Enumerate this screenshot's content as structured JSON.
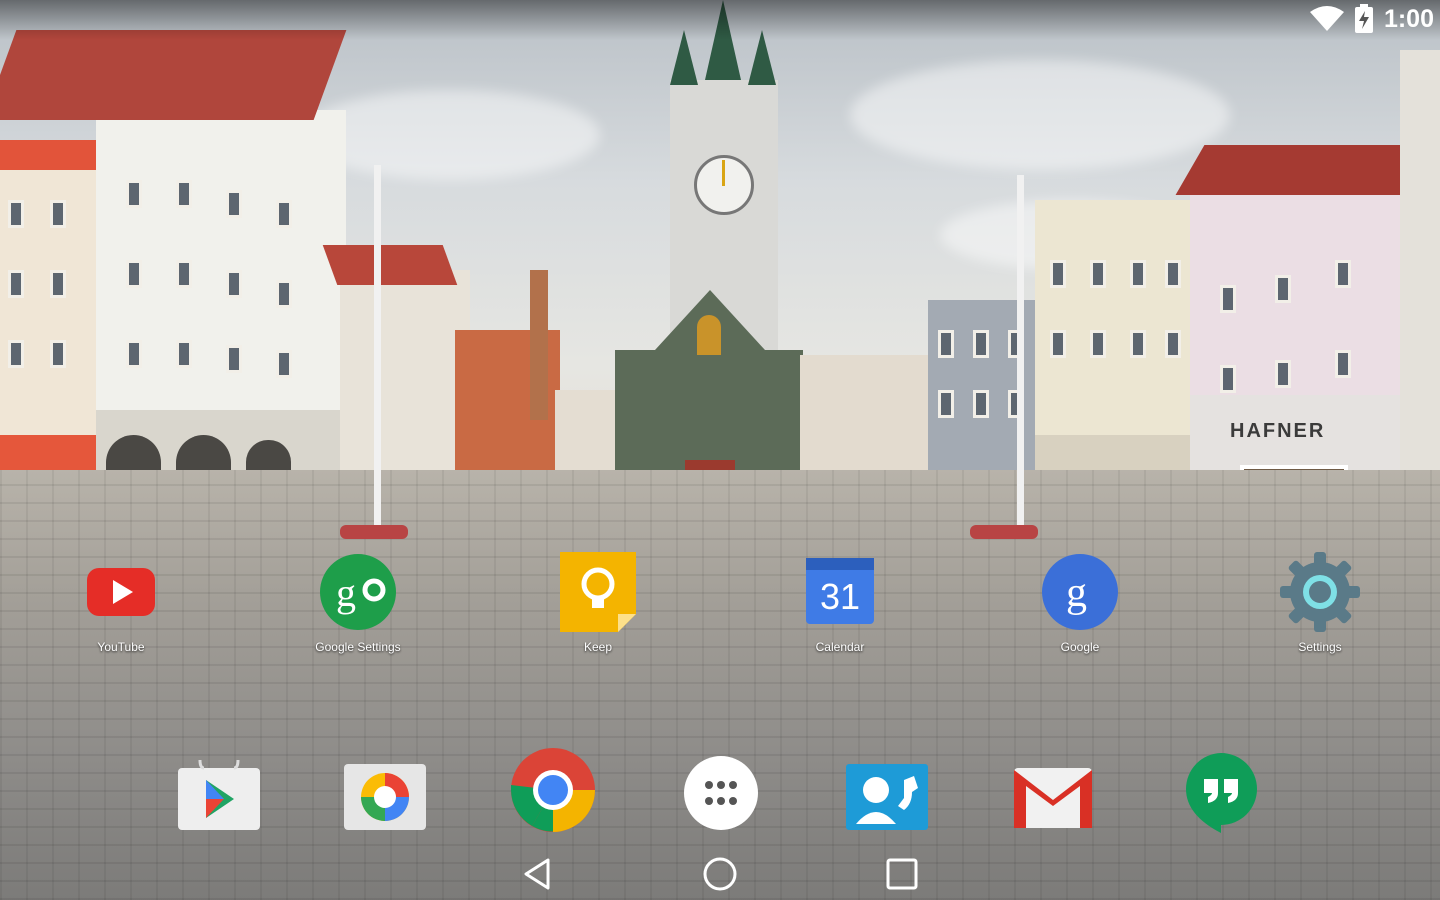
{
  "status_bar": {
    "time": "1:00",
    "icons": [
      "wifi-icon",
      "battery-charging-icon"
    ]
  },
  "wallpaper": {
    "storefront_sign": "HAFNER"
  },
  "home_apps": [
    {
      "label": "YouTube",
      "icon": "youtube-icon",
      "color": "#e52d27"
    },
    {
      "label": "Google Settings",
      "icon": "google-settings-icon",
      "color": "#1e9e4a"
    },
    {
      "label": "Keep",
      "icon": "keep-icon",
      "color": "#f4b400"
    },
    {
      "label": "Calendar",
      "icon": "calendar-icon",
      "color": "#3f7be6",
      "date": "31"
    },
    {
      "label": "Google",
      "icon": "google-icon",
      "color": "#3b6fd8"
    },
    {
      "label": "Settings",
      "icon": "settings-gear-icon",
      "color": "#5a7a88"
    }
  ],
  "dock_apps": [
    {
      "name": "Play Store",
      "icon": "play-store-icon"
    },
    {
      "name": "Photos",
      "icon": "photos-icon"
    },
    {
      "name": "Chrome",
      "icon": "chrome-icon"
    },
    {
      "name": "App Drawer",
      "icon": "app-drawer-icon"
    },
    {
      "name": "Contacts",
      "icon": "contacts-icon"
    },
    {
      "name": "Gmail",
      "icon": "gmail-icon"
    },
    {
      "name": "Hangouts",
      "icon": "hangouts-icon"
    }
  ],
  "nav_bar": {
    "buttons": [
      "back-icon",
      "home-icon",
      "recents-icon"
    ]
  }
}
